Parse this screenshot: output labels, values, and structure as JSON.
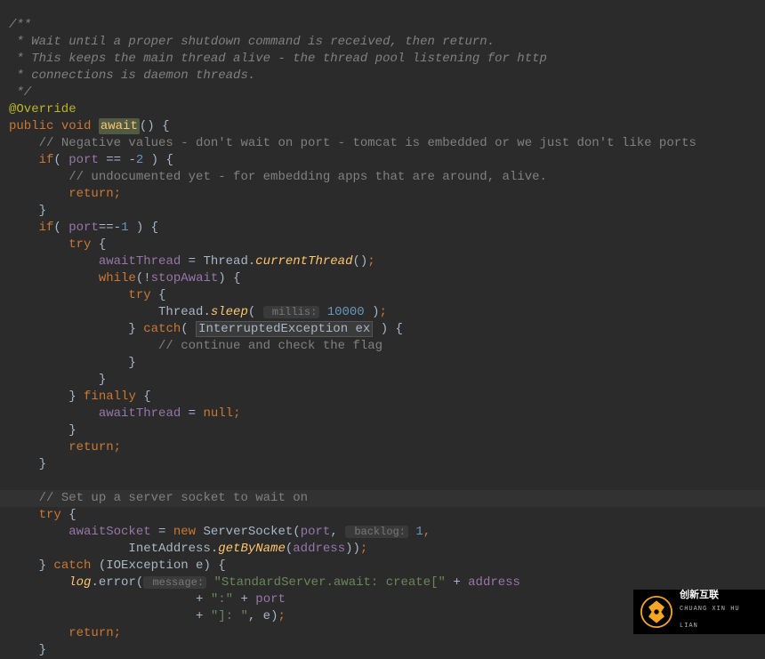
{
  "code": {
    "c1": "/**",
    "c2": " * Wait until a proper shutdown command is received, then return.",
    "c3": " * This keeps the main thread alive - the thread pool listening for http",
    "c4": " * connections is daemon threads.",
    "c5": " */",
    "annotation": "@Override",
    "kw_public": "public",
    "kw_void": "void",
    "method_await": "await",
    "paren_open": "()",
    "brace": " {",
    "neg_comment": "// Negative values - don't wait on port - tomcat is embedded or we just don't like ports",
    "if1": "if",
    "if1_open": "( ",
    "port": "port",
    "eqeq": " == -",
    "two": "2",
    "if1_close": " ) {",
    "undoc_comment": "// undocumented yet - for embedding apps that are around, alive.",
    "return1": "return",
    "semicolon": ";",
    "close_brace": "}",
    "if2": "if",
    "if2_open": "( ",
    "eqeq2": "==-",
    "one": "1",
    "if2_close": " ) {",
    "try1": "try",
    "try1_brace": " {",
    "awaitThread": "awaitThread",
    "eq_thread": " = Thread.",
    "currentThread": "currentThread",
    "paren_semi": "()",
    "while1": "while",
    "while_open": "(!",
    "stopAwait": "stopAwait",
    "while_close": ") {",
    "try2": "try",
    "try2_brace": " {",
    "thread_prefix": "Thread.",
    "sleep": "sleep",
    "sleep_open": "( ",
    "millis_hint": " millis:",
    "ten_thousand": "10000",
    "sleep_close": " )",
    "catch1": "catch",
    "catch1_open": "( ",
    "interrupted": "InterruptedException ex",
    "catch1_close": " ) {",
    "continue_comment": "// continue and check the flag",
    "finally1": "finally",
    "finally_brace": " {",
    "eq_null": " = ",
    "null_kw": "null",
    "empty_line": "",
    "setup_comment": "// Set up a server socket to wait on",
    "try3": "try",
    "try3_brace": " {",
    "awaitSocket": "awaitSocket",
    "eq_new": " = ",
    "new_kw": "new",
    "server_socket": " ServerSocket(",
    "comma": ", ",
    "backlog_hint": " backlog:",
    "one_b": "1",
    "inet_prefix": "InetAddress.",
    "getByName": "getByName",
    "getbyname_open": "(",
    "address": "address",
    "getbyname_close": "))",
    "catch2": "catch",
    "catch2_open": " (IOException e) {",
    "log": "log",
    "dot_error": ".error(",
    "message_hint": " message:",
    "str1": "\"StandardServer.await: create[\"",
    "plus": " + ",
    "str_colon": "\":\"",
    "str_bracket": "\"]: \"",
    "e_close": ", e)"
  },
  "badge": {
    "brand": "创新互联",
    "url": "CHUANG XIN HU LIAN"
  }
}
